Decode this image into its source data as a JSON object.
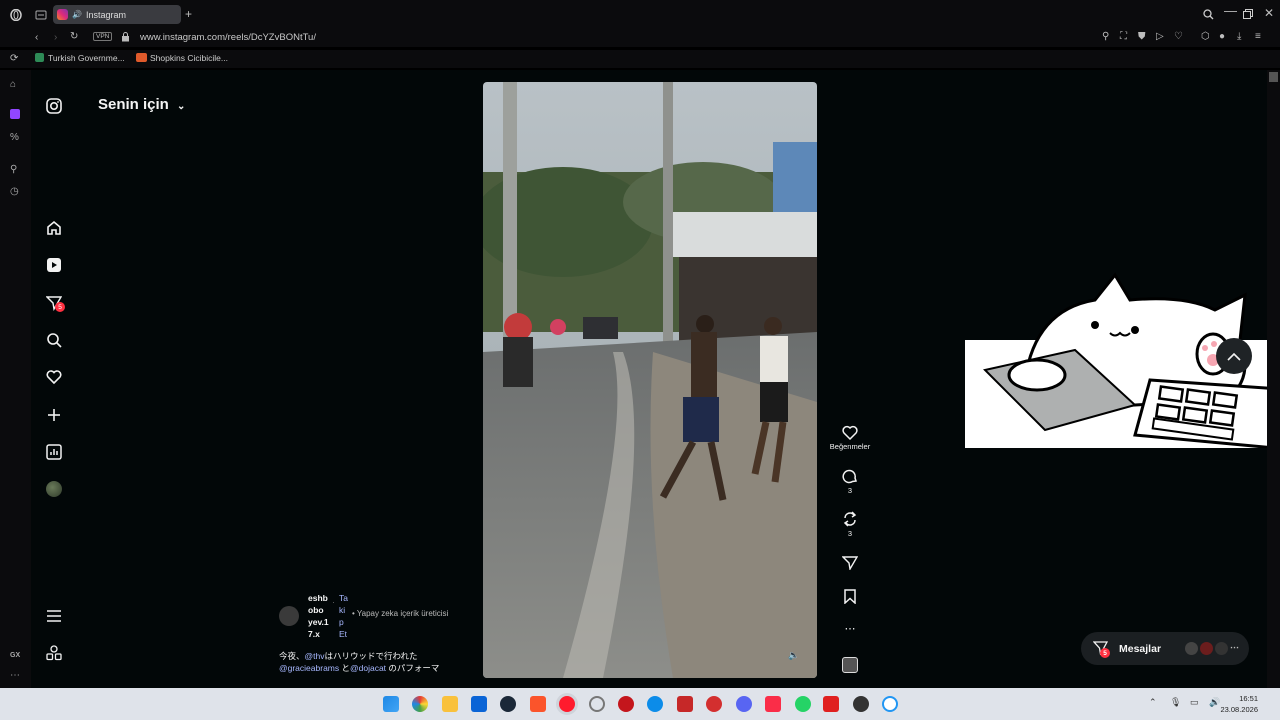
{
  "browser": {
    "tab_title": "Instagram",
    "url": "www.instagram.com/reels/DcYZvBONtTu/",
    "vpn_label": "VPN",
    "bookmarks": [
      "Turkish Governme...",
      "Shopkins Cicibicile..."
    ]
  },
  "feed": {
    "title": "Senin için",
    "notification_count": "5"
  },
  "reel": {
    "like_label": "Beğenmeler",
    "comment_count": "3",
    "repost_count": "3",
    "username_lines": [
      "eshb",
      "obo",
      "yev.1",
      "7.x"
    ],
    "follow_lines": [
      "Ta",
      "ki",
      "p",
      "Et"
    ],
    "ai_label": "• Yapay zeka içerik üreticisi",
    "caption_line1_prefix": "今夜、",
    "caption_mention1": "@thv",
    "caption_line1_rest": "はハリウッドで行われた",
    "caption_mention2": "@gracieabrams",
    "caption_and": " と",
    "caption_mention3": "@dojacat",
    "caption_line2_rest": " のパフォーマ"
  },
  "messages": {
    "label": "Mesajlar",
    "badge": "5"
  },
  "sidebar_bottom": {
    "gx_label": "GX"
  },
  "taskbar": {
    "time": "16:51",
    "date": "23.08.2026"
  },
  "colors": {
    "accent_link": "#a8b8ff",
    "badge": "#ff3040",
    "bg": "#020708"
  }
}
